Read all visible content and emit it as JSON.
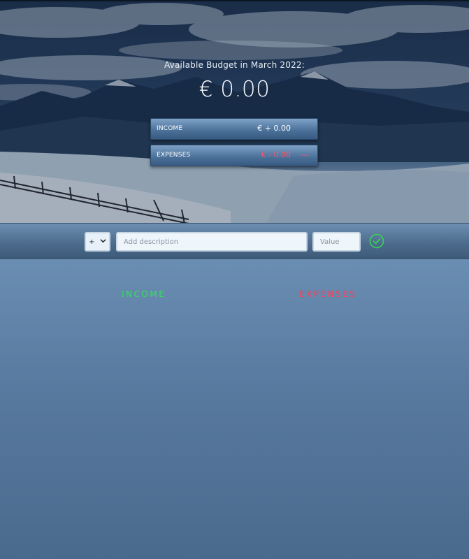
{
  "budget": {
    "title": "Available Budget in March 2022:",
    "value": "€ 0.00",
    "income": {
      "label": "INCOME",
      "value": "€ + 0.00"
    },
    "expenses": {
      "label": "EXPENSES",
      "value": "€ - 0.00",
      "percentage": "---"
    }
  },
  "add_form": {
    "type_selected": "+",
    "type_options": [
      "+",
      "-"
    ],
    "description_placeholder": "Add description",
    "value_placeholder": "Value",
    "submit_icon": "check-circle-icon"
  },
  "lists": {
    "income_title": "INCOME",
    "expenses_title": "EXPENSES",
    "income_items": [],
    "expense_items": []
  },
  "colors": {
    "income_accent": "#33e35b",
    "expense_accent": "#ff3e58",
    "submit_icon": "#39d353"
  }
}
